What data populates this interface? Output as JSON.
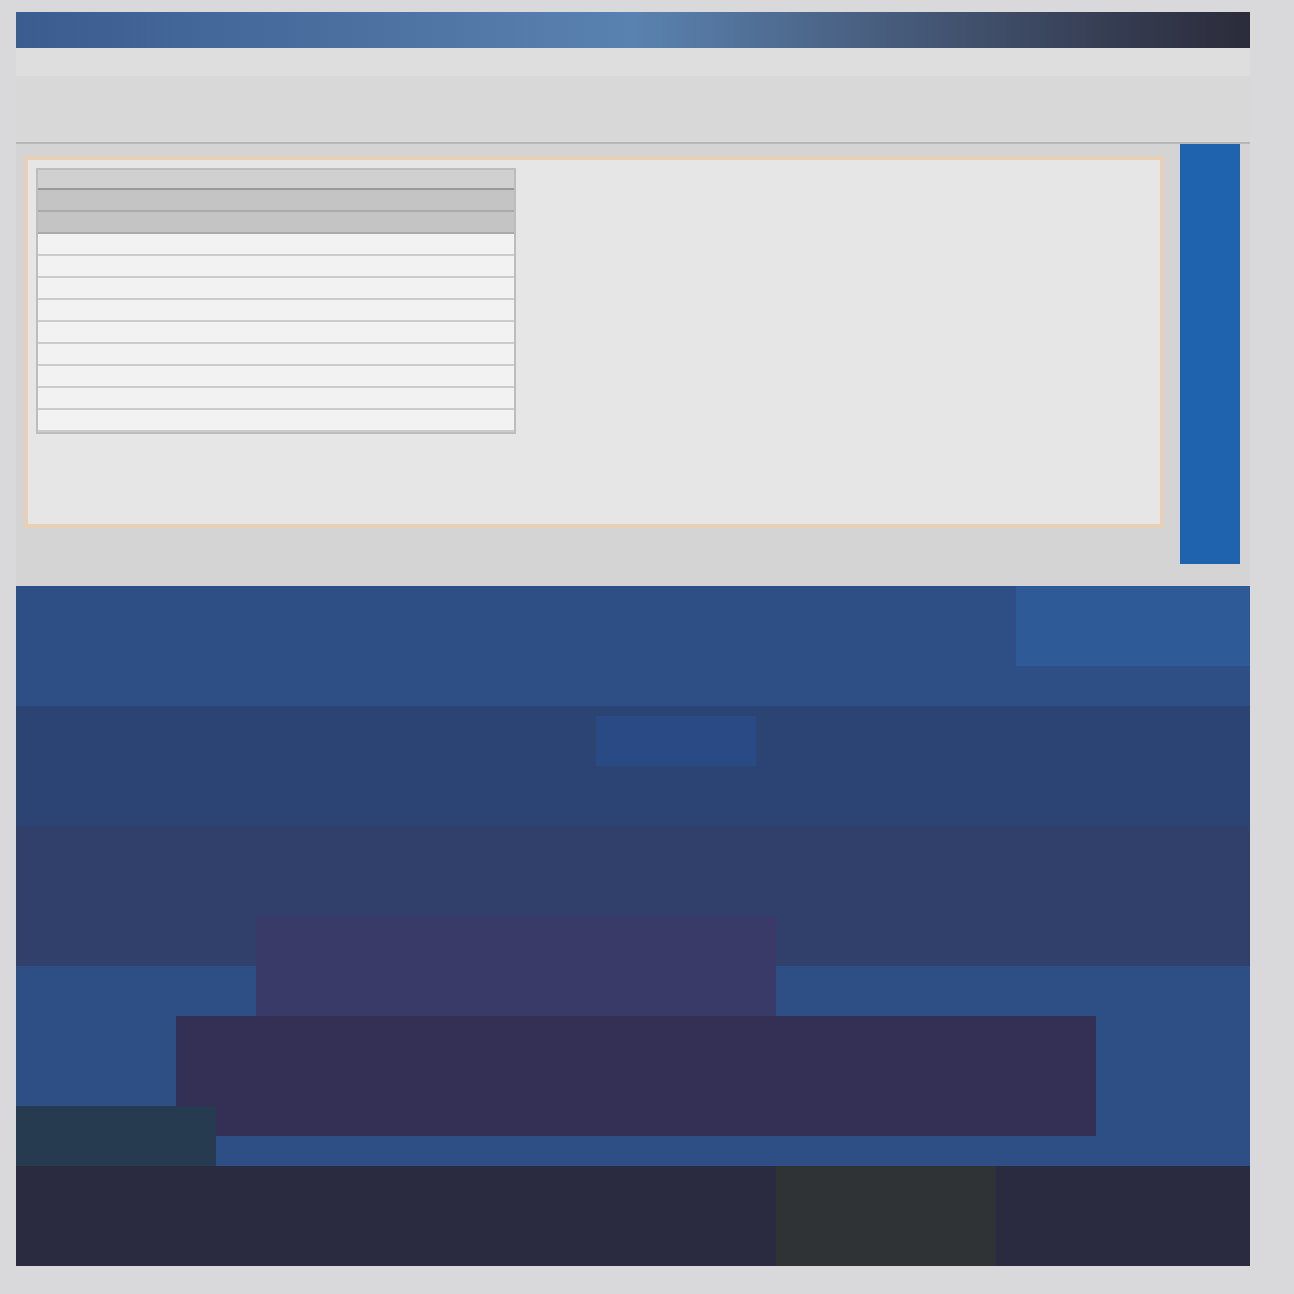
{
  "table": {
    "rows": [
      {
        "selected": true
      },
      {
        "selected": true
      },
      {
        "selected": false
      },
      {
        "selected": false
      },
      {
        "selected": false
      },
      {
        "selected": false
      },
      {
        "selected": false
      },
      {
        "selected": false
      },
      {
        "selected": false
      },
      {
        "selected": false
      },
      {
        "selected": false
      }
    ]
  }
}
